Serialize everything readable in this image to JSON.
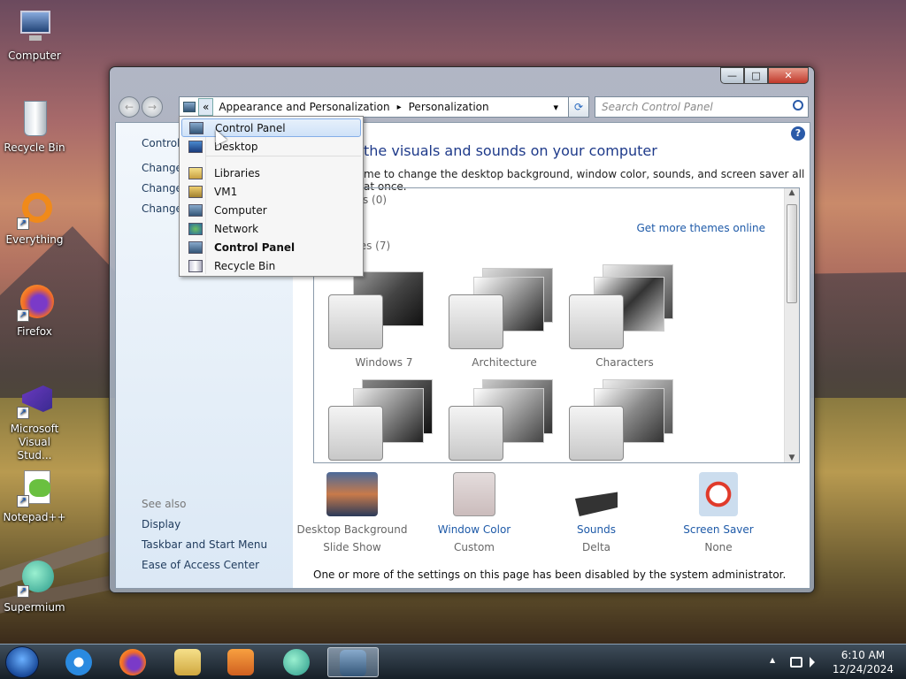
{
  "desktop": {
    "icons": [
      {
        "label": "Computer",
        "icon": "computer-icon"
      },
      {
        "label": "Recycle Bin",
        "icon": "recycle-bin-icon"
      },
      {
        "label": "Everything",
        "icon": "everything-icon"
      },
      {
        "label": "Firefox",
        "icon": "firefox-icon"
      },
      {
        "label": "Microsoft Visual Stud...",
        "icon": "visual-studio-icon"
      },
      {
        "label": "Notepad++",
        "icon": "notepadpp-icon"
      },
      {
        "label": "Supermium",
        "icon": "supermium-icon"
      }
    ]
  },
  "window": {
    "controls": {
      "minimize": "—",
      "maximize": "□",
      "close": "✕"
    },
    "nav": {
      "back": "←",
      "forward": "→"
    },
    "address": {
      "overflow": "«",
      "crumb1": "Appearance and Personalization",
      "sep": "▸",
      "crumb2": "Personalization",
      "dropdown_arrow": "▾"
    },
    "refresh": "⟳",
    "search_placeholder": "Search Control Panel",
    "help": "?",
    "left_pane": {
      "home_link": "Control",
      "links": [
        "Change",
        "Change",
        "Change"
      ],
      "see_also_heading": "See also",
      "see_also": [
        "Display",
        "Taskbar and Start Menu",
        "Ease of Access Center"
      ]
    },
    "main": {
      "title": "the visuals and sounds on your computer",
      "subtitle": "me to change the desktop background, window color, sounds, and screen saver all at once.",
      "my_themes": "nes (0)",
      "get_more": "Get more themes online",
      "aero_themes": "mes (7)",
      "themes": [
        {
          "name": "Windows 7"
        },
        {
          "name": "Architecture"
        },
        {
          "name": "Characters"
        },
        {
          "name": ""
        },
        {
          "name": ""
        },
        {
          "name": ""
        }
      ],
      "bottom": [
        {
          "label": "Desktop Background",
          "value": "Slide Show",
          "disabled": true
        },
        {
          "label": "Window Color",
          "value": "Custom",
          "disabled": false
        },
        {
          "label": "Sounds",
          "value": "Delta",
          "disabled": false
        },
        {
          "label": "Screen Saver",
          "value": "None",
          "disabled": false
        }
      ],
      "notice": "One or more of the settings on this page has been disabled by the system administrator."
    }
  },
  "dropdown": {
    "items": [
      {
        "label": "Control Panel",
        "selected": true,
        "bold": false
      },
      {
        "label": "Desktop",
        "selected": false,
        "bold": false
      },
      {
        "label": "Libraries",
        "selected": false,
        "bold": false
      },
      {
        "label": "VM1",
        "selected": false,
        "bold": false
      },
      {
        "label": "Computer",
        "selected": false,
        "bold": false
      },
      {
        "label": "Network",
        "selected": false,
        "bold": false
      },
      {
        "label": "Control Panel",
        "selected": false,
        "bold": true
      },
      {
        "label": "Recycle Bin",
        "selected": false,
        "bold": false
      }
    ]
  },
  "taskbar": {
    "apps": [
      "internet-explorer-icon",
      "firefox-icon",
      "file-explorer-icon",
      "media-player-icon",
      "supermium-icon",
      "control-panel-icon"
    ],
    "tray_arrow": "▲",
    "time": "6:10 AM",
    "date": "12/24/2024"
  }
}
